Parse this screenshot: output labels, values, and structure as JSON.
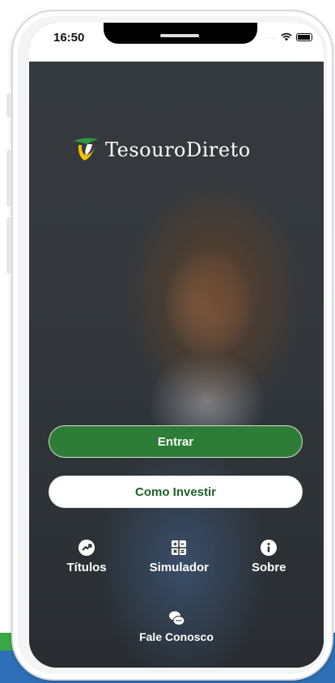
{
  "status_bar": {
    "time": "16:50"
  },
  "brand": {
    "name": "TesouroDireto",
    "green": "#2e7d37",
    "yellow": "#f2c200"
  },
  "actions": {
    "login_label": "Entrar",
    "how_to_invest_label": "Como Investir"
  },
  "menu": {
    "items": [
      {
        "label": "Títulos",
        "icon": "trending-up-icon"
      },
      {
        "label": "Simulador",
        "icon": "calculator-icon"
      },
      {
        "label": "Sobre",
        "icon": "info-icon"
      }
    ]
  },
  "contact": {
    "label": "Fale Conosco",
    "icon": "chat-bubbles-icon"
  }
}
